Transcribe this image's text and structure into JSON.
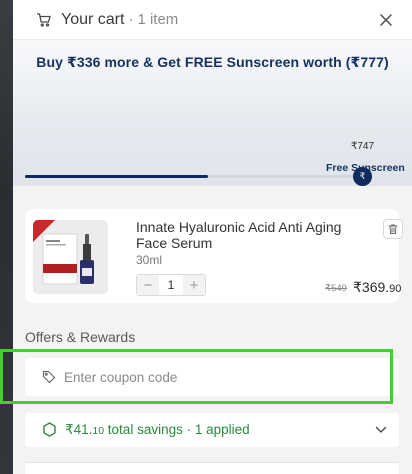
{
  "header": {
    "title": "Your cart",
    "separator": "·",
    "count": "1 item",
    "cart_icon": "cart-icon",
    "close_icon": "close-icon"
  },
  "promo": {
    "message": "Buy ₹336 more & Get FREE Sunscreen worth (₹777)",
    "tier_price": "₹747",
    "tier_marker": "₹",
    "tier_label": "Free Sunscreen",
    "progress_fraction": 0.55
  },
  "cart_items": [
    {
      "name": "Innate Hyaluronic Acid Anti Aging Face Serum",
      "size": "30ml",
      "quantity": "1",
      "minus_label": "−",
      "plus_label": "+",
      "original_price": "₹549",
      "price_main": "₹369.",
      "price_decimal": "90",
      "delete_icon": "trash-icon"
    }
  ],
  "offers": {
    "title": "Offers & Rewards",
    "coupon_placeholder": "Enter coupon code",
    "coupon_icon": "tag-icon",
    "savings_main": "₹41.",
    "savings_decimal": "10",
    "savings_rest": " total savings · 1 applied",
    "savings_icon": "badge-icon",
    "expand_icon": "chevron-down-icon"
  },
  "colors": {
    "brand_navy": "#14315f",
    "savings_green": "#2a8a3d",
    "highlight_green": "#3fd22a"
  }
}
